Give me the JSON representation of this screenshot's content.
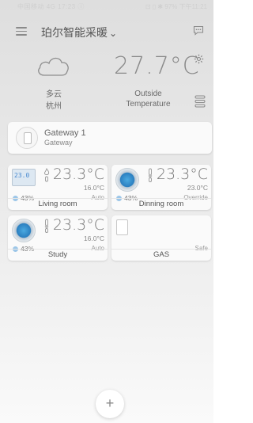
{
  "status_bar": {
    "left": "中国移动 4G 17:23 ⓘ",
    "right": "⊡ ▯ ✱ 97% 下午11:21"
  },
  "header": {
    "title": "珀尔智能采暖",
    "chevron": "⌄"
  },
  "weather": {
    "condition": "多云",
    "city": "杭州",
    "temperature": "27.7°C",
    "outside_line1": "Outside",
    "outside_line2": "Temperature"
  },
  "gateway": {
    "name": "Gateway 1",
    "subtitle": "Gateway"
  },
  "devices": [
    {
      "room": "Living room",
      "temp": "23.3°C",
      "setpoint": "16.0°C",
      "mode": "Auto",
      "humidity": "43%",
      "display": "23.0"
    },
    {
      "room": "Dinning room",
      "temp": "23.3°C",
      "setpoint": "23.0°C",
      "mode": "Override",
      "humidity": "43%"
    },
    {
      "room": "Study",
      "temp": "23.3°C",
      "setpoint": "16.0°C",
      "mode": "Auto",
      "humidity": "43%"
    },
    {
      "room": "GAS",
      "mode": "Safe"
    }
  ],
  "fab": {
    "label": "+"
  },
  "icons": {
    "menu": "menu-icon",
    "chat": "chat-icon",
    "cloud": "cloud-icon",
    "gear": "gear-icon",
    "list": "list-icon",
    "flame": "flame-icon",
    "thermometer": "thermometer-icon"
  }
}
